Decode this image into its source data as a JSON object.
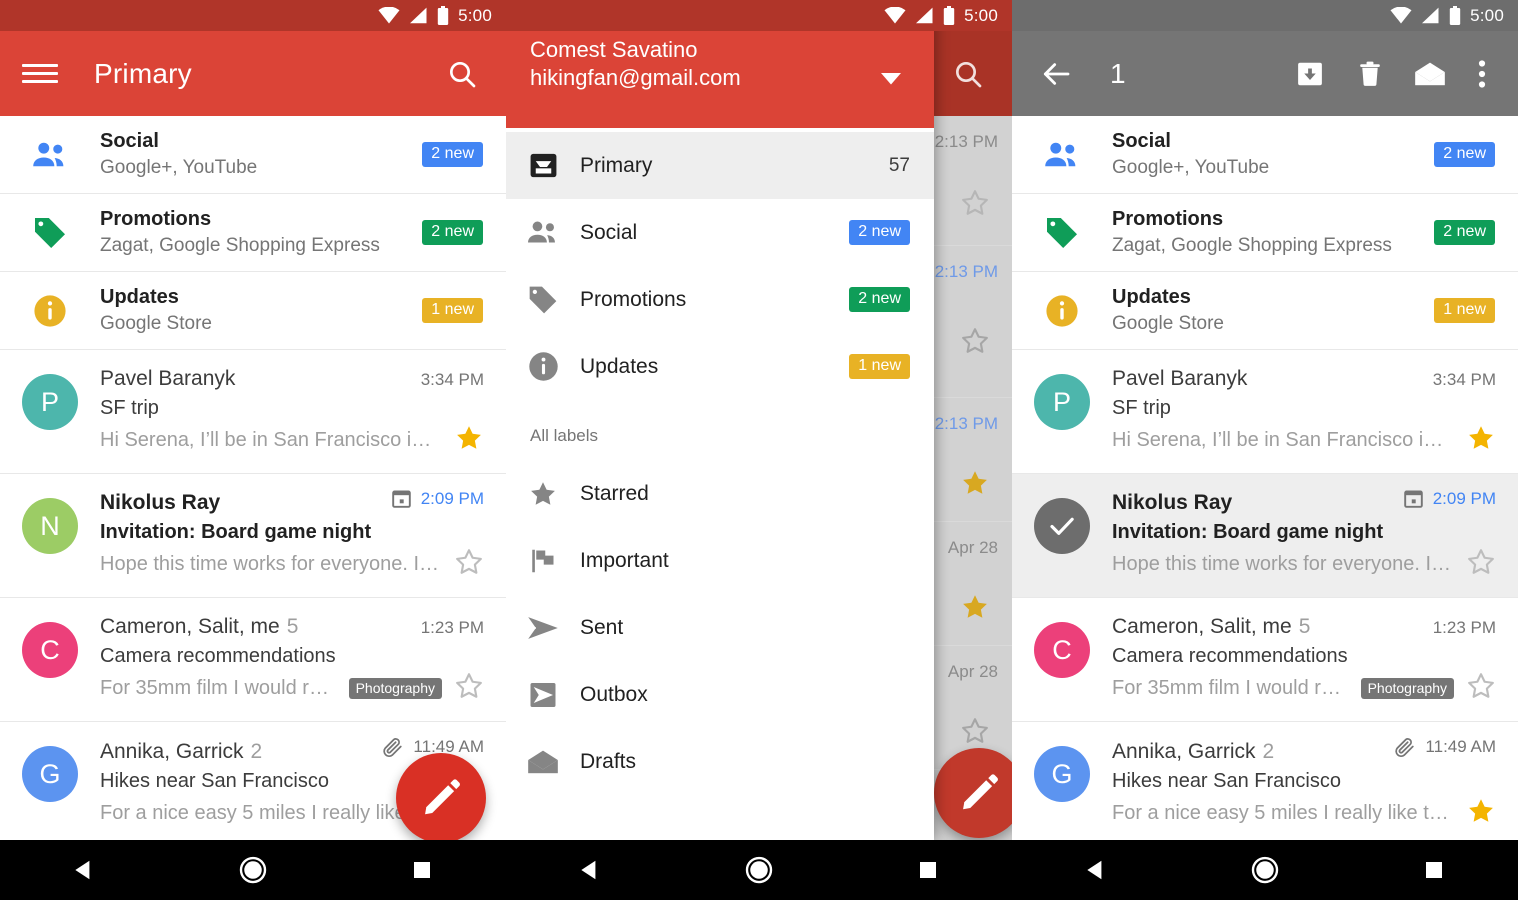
{
  "statusbar": {
    "time": "5:00",
    "icons": [
      "wifi-icon",
      "signal-icon",
      "battery-icon"
    ]
  },
  "colors": {
    "appbar_red": "#db4437",
    "appbar_gray": "#757575",
    "status_red": "#b03529",
    "status_gray": "#6d6d6d",
    "badge_blue": "#4285f4",
    "badge_green": "#0f9d58",
    "badge_yellow": "#e8b225",
    "fab_red": "#d93025",
    "star_gold": "#f4b400",
    "link_blue": "#4285f4"
  },
  "panel_inbox": {
    "appbar": {
      "menu_icon": "hamburger-menu-icon",
      "title": "Primary",
      "search_icon": "search-icon"
    },
    "fab": {
      "icon": "pencil-compose-icon"
    }
  },
  "panel_drawer": {
    "account": {
      "name": "Comest Savatino",
      "email": "hikingfan@gmail.com",
      "caret_icon": "chevron-down-icon"
    },
    "inboxes": [
      {
        "icon": "inbox-icon",
        "label": "Primary",
        "count": "57",
        "badge": null,
        "active": true
      },
      {
        "icon": "people-icon",
        "label": "Social",
        "count": null,
        "badge": "2 new",
        "badge_color": "blue",
        "active": false
      },
      {
        "icon": "tag-icon",
        "label": "Promotions",
        "count": null,
        "badge": "2 new",
        "badge_color": "green",
        "active": false
      },
      {
        "icon": "info-icon",
        "label": "Updates",
        "count": null,
        "badge": "1 new",
        "badge_color": "yellow",
        "active": false
      }
    ],
    "section_label": "All labels",
    "labels": [
      {
        "icon": "star-icon",
        "label": "Starred"
      },
      {
        "icon": "flag-icon",
        "label": "Important"
      },
      {
        "icon": "send-icon",
        "label": "Sent"
      },
      {
        "icon": "outbox-icon",
        "label": "Outbox"
      },
      {
        "icon": "drafts-icon",
        "label": "Drafts"
      }
    ],
    "background_rows": [
      {
        "time": "2:13 PM",
        "time_blue": false,
        "starred": false
      },
      {
        "time": "2:13 PM",
        "time_blue": true,
        "starred": false
      },
      {
        "time": "2:13 PM",
        "time_blue": true,
        "starred": true
      },
      {
        "time": "Apr 28",
        "time_blue": false,
        "starred": true
      },
      {
        "time": "Apr 28",
        "time_blue": false,
        "starred": false
      }
    ],
    "background_appbar": {
      "search_icon": "search-icon"
    }
  },
  "panel_selection": {
    "appbar": {
      "back_icon": "arrow-back-icon",
      "count": "1",
      "actions": [
        {
          "icon": "archive-icon",
          "name": "archive-button"
        },
        {
          "icon": "trash-icon",
          "name": "delete-button"
        },
        {
          "icon": "mail-open-icon",
          "name": "mark-read-button"
        },
        {
          "icon": "more-vert-icon",
          "name": "overflow-menu-button"
        }
      ]
    }
  },
  "categories": [
    {
      "icon": "people-icon",
      "icon_color": "#4285f4",
      "title": "Social",
      "subtitle": "Google+, YouTube",
      "badge": "2 new",
      "badge_color": "blue"
    },
    {
      "icon": "tag-icon",
      "icon_color": "#0f9d58",
      "title": "Promotions",
      "subtitle": "Zagat, Google Shopping Express",
      "badge": "2 new",
      "badge_color": "green"
    },
    {
      "icon": "info-icon",
      "icon_color": "#e8b225",
      "title": "Updates",
      "subtitle": "Google Store",
      "badge": "1 new",
      "badge_color": "yellow"
    }
  ],
  "emails": [
    {
      "avatar_letter": "P",
      "avatar_color": "#4db6ac",
      "sender": "Pavel Baranyk",
      "count": null,
      "time": "3:34 PM",
      "time_blue": false,
      "subject": "SF trip",
      "snippet": "Hi Serena, I’ll be in San Francisco in a…",
      "unread": false,
      "starred": true,
      "chip": null,
      "calendar_icon": false,
      "attachment_icon": false,
      "selected": false
    },
    {
      "avatar_letter": "N",
      "avatar_color": "#9ccc65",
      "sender": "Nikolus Ray",
      "count": null,
      "time": "2:09 PM",
      "time_blue": true,
      "subject": "Invitation: Board game night",
      "snippet": "Hope this time works for everyone. I’m…",
      "unread": true,
      "starred": false,
      "chip": null,
      "calendar_icon": true,
      "attachment_icon": false,
      "selected": false
    },
    {
      "avatar_letter": "C",
      "avatar_color": "#ec407a",
      "sender": "Cameron, Salit, me",
      "count": "5",
      "time": "1:23 PM",
      "time_blue": false,
      "subject": "Camera recommendations",
      "snippet": "For 35mm film I would re…",
      "unread": false,
      "starred": false,
      "chip": "Photography",
      "calendar_icon": false,
      "attachment_icon": false,
      "selected": false
    },
    {
      "avatar_letter": "G",
      "avatar_color": "#5c94f0",
      "sender": "Annika, Garrick",
      "count": "2",
      "time": "11:49 AM",
      "time_blue": false,
      "subject": "Hikes near San Francisco",
      "snippet": "For a nice easy 5 miles I really like th…",
      "unread": false,
      "starred": true,
      "chip": null,
      "calendar_icon": false,
      "attachment_icon": true,
      "selected": false
    }
  ],
  "navbar": [
    {
      "icon": "back-triangle-icon",
      "name": "nav-back-button"
    },
    {
      "icon": "home-circle-icon",
      "name": "nav-home-button"
    },
    {
      "icon": "recents-square-icon",
      "name": "nav-recents-button"
    }
  ]
}
